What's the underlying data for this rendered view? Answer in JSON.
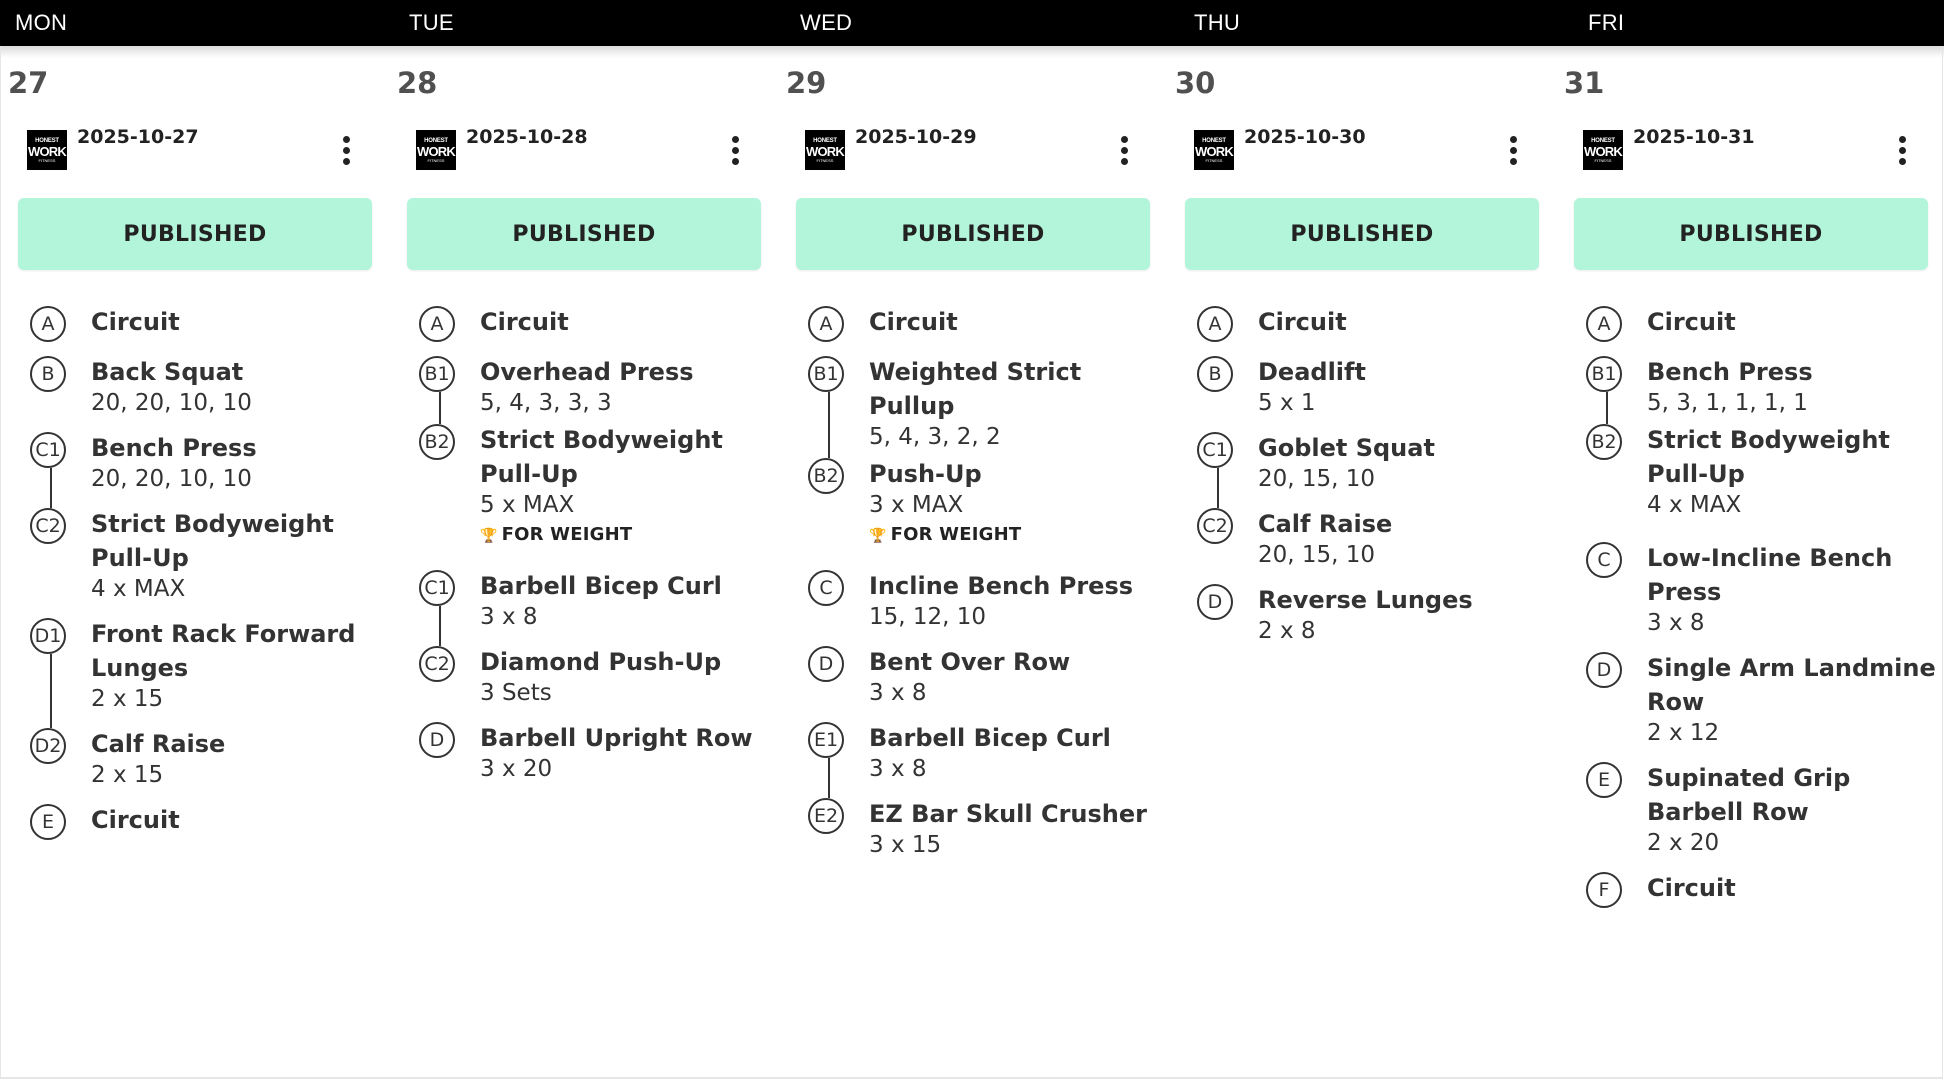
{
  "colors": {
    "header_bg": "#000000",
    "published_bg": "#b3f5db",
    "trophy": "#3cc29b"
  },
  "logo": {
    "line1": "HONEST",
    "line2": "WORK",
    "line3": "FITNESS"
  },
  "days": [
    {
      "name": "MON",
      "number": "27",
      "date": "2025-10-27",
      "status": "PUBLISHED",
      "exercises": [
        {
          "badge": "A",
          "name": "Circuit"
        },
        {
          "badge": "B",
          "name": "Back Squat",
          "detail": "20, 20, 10, 10"
        },
        {
          "badge": "C1",
          "name": "Bench Press",
          "detail": "20, 20, 10, 10"
        },
        {
          "badge": "C2",
          "name": "Strict Bodyweight Pull-Up",
          "detail": "4 x MAX"
        },
        {
          "badge": "D1",
          "name": "Front Rack Forward Lunges",
          "detail": "2 x 15"
        },
        {
          "badge": "D2",
          "name": "Calf Raise",
          "detail": "2 x 15"
        },
        {
          "badge": "E",
          "name": "Circuit"
        }
      ]
    },
    {
      "name": "TUE",
      "number": "28",
      "date": "2025-10-28",
      "status": "PUBLISHED",
      "exercises": [
        {
          "badge": "A",
          "name": "Circuit"
        },
        {
          "badge": "B1",
          "name": "Overhead Press",
          "detail": "5, 4, 3, 3, 3"
        },
        {
          "badge": "B2",
          "name": "Strict Bodyweight Pull-Up",
          "detail": "5 x MAX",
          "flag": "FOR WEIGHT"
        },
        {
          "badge": "C1",
          "name": "Barbell Bicep Curl",
          "detail": "3 x 8"
        },
        {
          "badge": "C2",
          "name": "Diamond Push-Up",
          "detail": "3 Sets"
        },
        {
          "badge": "D",
          "name": "Barbell Upright Row",
          "detail": "3 x 20"
        }
      ]
    },
    {
      "name": "WED",
      "number": "29",
      "date": "2025-10-29",
      "status": "PUBLISHED",
      "exercises": [
        {
          "badge": "A",
          "name": "Circuit"
        },
        {
          "badge": "B1",
          "name": "Weighted Strict Pullup",
          "detail": "5, 4, 3, 2, 2"
        },
        {
          "badge": "B2",
          "name": "Push-Up",
          "detail": "3 x MAX",
          "flag": "FOR WEIGHT"
        },
        {
          "badge": "C",
          "name": "Incline Bench Press",
          "detail": "15, 12, 10"
        },
        {
          "badge": "D",
          "name": "Bent Over Row",
          "detail": "3 x 8"
        },
        {
          "badge": "E1",
          "name": "Barbell Bicep Curl",
          "detail": "3 x 8"
        },
        {
          "badge": "E2",
          "name": "EZ Bar Skull Crusher",
          "detail": "3 x 15"
        }
      ]
    },
    {
      "name": "THU",
      "number": "30",
      "date": "2025-10-30",
      "status": "PUBLISHED",
      "exercises": [
        {
          "badge": "A",
          "name": "Circuit"
        },
        {
          "badge": "B",
          "name": "Deadlift",
          "detail": "5 x 1"
        },
        {
          "badge": "C1",
          "name": "Goblet Squat",
          "detail": "20, 15, 10"
        },
        {
          "badge": "C2",
          "name": "Calf Raise",
          "detail": "20, 15, 10"
        },
        {
          "badge": "D",
          "name": "Reverse Lunges",
          "detail": "2 x 8"
        }
      ]
    },
    {
      "name": "FRI",
      "number": "31",
      "date": "2025-10-31",
      "status": "PUBLISHED",
      "exercises": [
        {
          "badge": "A",
          "name": "Circuit"
        },
        {
          "badge": "B1",
          "name": "Bench Press",
          "detail": "5, 3, 1, 1, 1, 1"
        },
        {
          "badge": "B2",
          "name": "Strict Bodyweight Pull-Up",
          "detail": "4 x MAX"
        },
        {
          "badge": "C",
          "name": "Low-Incline Bench Press",
          "detail": "3 x 8"
        },
        {
          "badge": "D",
          "name": "Single Arm Landmine Row",
          "detail": "2 x 12"
        },
        {
          "badge": "E",
          "name": "Supinated Grip Barbell Row",
          "detail": "2 x 20"
        },
        {
          "badge": "F",
          "name": "Circuit"
        }
      ]
    }
  ]
}
